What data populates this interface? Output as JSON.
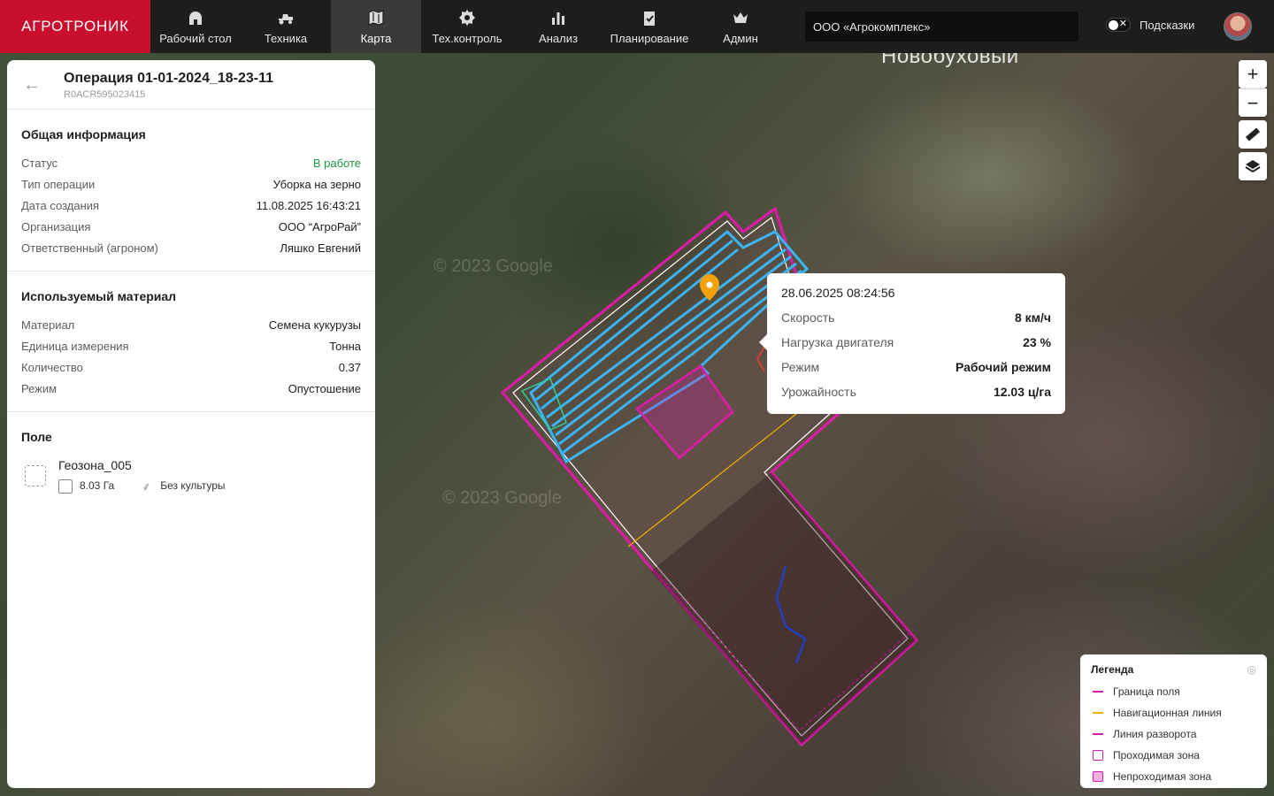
{
  "topbar": {
    "logo": "АГРОТРОНИК",
    "nav": [
      {
        "label": "Рабочий стол",
        "icon": "dashboard-icon"
      },
      {
        "label": "Техника",
        "icon": "tractor-icon"
      },
      {
        "label": "Карта",
        "icon": "map-icon",
        "active": true
      },
      {
        "label": "Тех.контроль",
        "icon": "gear-icon"
      },
      {
        "label": "Анализ",
        "icon": "bar-chart-icon"
      },
      {
        "label": "Планирование",
        "icon": "clipboard-check-icon"
      },
      {
        "label": "Админ",
        "icon": "crown-icon"
      }
    ],
    "organization": "ООО «Агрокомплекс»",
    "hints_label": "Подсказки",
    "hints_enabled": false
  },
  "panel": {
    "title": "Операция 01-01-2024_18-23-11",
    "id": "R0ACR595023415",
    "general": {
      "heading": "Общая информация",
      "rows": [
        {
          "k": "Статус",
          "v": "В работе"
        },
        {
          "k": "Тип операции",
          "v": "Уборка на зерно"
        },
        {
          "k": "Дата создания",
          "v": "11.08.2025 16:43:21"
        },
        {
          "k": "Организация",
          "v": "ООО “АгроРай”"
        },
        {
          "k": "Ответственный (агроном)",
          "v": "Ляшко Евгений"
        }
      ]
    },
    "material": {
      "heading": "Используемый материал",
      "rows": [
        {
          "k": "Материал",
          "v": "Семена кукурузы"
        },
        {
          "k": "Единица измерения",
          "v": "Тонна"
        },
        {
          "k": "Количество",
          "v": "0.37"
        },
        {
          "k": "Режим",
          "v": "Опустошение"
        }
      ]
    },
    "field": {
      "heading": "Поле",
      "name": "Геозона_005",
      "area": "8.03 Га",
      "crop": "Без культуры"
    }
  },
  "map": {
    "place_label": "Новобуховый",
    "watermark": "© 2023 Google"
  },
  "tooltip": {
    "time": "28.06.2025 08:24:56",
    "rows": [
      {
        "k": "Скорость",
        "v": "8 км/ч"
      },
      {
        "k": "Нагрузка двигателя",
        "v": "23 %"
      },
      {
        "k": "Режим",
        "v": "Рабочий режим"
      },
      {
        "k": "Урожайность",
        "v": "12.03 ц/га"
      }
    ]
  },
  "legend": {
    "title": "Легенда",
    "items": [
      {
        "label": "Граница поля",
        "color": "#e01aa8",
        "kind": "line"
      },
      {
        "label": "Навигационная линия",
        "color": "#f0b400",
        "kind": "line"
      },
      {
        "label": "Линия разворота",
        "color": "#e01aa8",
        "kind": "dash"
      },
      {
        "label": "Проходимая зона",
        "color": "#e01aa8",
        "kind": "box"
      },
      {
        "label": "Непроходимая зона",
        "color": "#e01aa8",
        "kind": "box-filled"
      }
    ]
  },
  "colors": {
    "brand": "#c8102e",
    "status_green": "#1e9b3e",
    "field_border": "#e01aa8",
    "track": "#3ab4f2",
    "nav_line": "#f0b400",
    "marker": "#f2a10a"
  }
}
